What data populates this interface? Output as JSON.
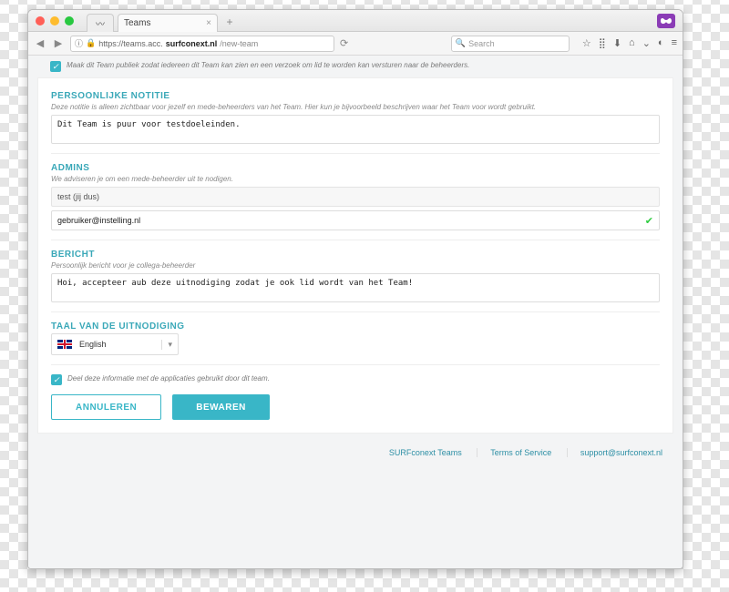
{
  "browser": {
    "tab_title": "Teams",
    "url_host": "surfconext.nl",
    "url_prefix": "https://teams.acc.",
    "url_path": "/new-team",
    "search_placeholder": "Search"
  },
  "topcheck": {
    "label": "Maak dit Team publiek zodat iedereen dit Team kan zien en een verzoek om lid te worden kan versturen naar de beheerders."
  },
  "note_section": {
    "title": "PERSOONLIJKE NOTITIE",
    "hint": "Deze notitie is alleen zichtbaar voor jezelf en mede-beheerders van het Team. Hier kun je bijvoorbeeld beschrijven waar het Team voor wordt gebruikt.",
    "value": "Dit Team is puur voor testdoeleinden."
  },
  "admins_section": {
    "title": "ADMINS",
    "hint": "We adviseren je om een mede-beheerder uit te nodigen.",
    "self": "test (jij dus)",
    "invitee": "gebruiker@instelling.nl"
  },
  "message_section": {
    "title": "BERICHT",
    "hint": "Persoonlijk bericht voor je collega-beheerder",
    "value": "Hoi, accepteer aub deze uitnodiging zodat je ook lid wordt van het Team!"
  },
  "lang_section": {
    "title": "TAAL VAN DE UITNODIGING",
    "selected": "English"
  },
  "share_check": {
    "label": "Deel deze informatie met de applicaties gebruikt door dit team."
  },
  "buttons": {
    "cancel": "ANNULEREN",
    "save": "BEWAREN"
  },
  "footer": {
    "app": "SURFconext Teams",
    "tos": "Terms of Service",
    "support": "support@surfconext.nl"
  }
}
